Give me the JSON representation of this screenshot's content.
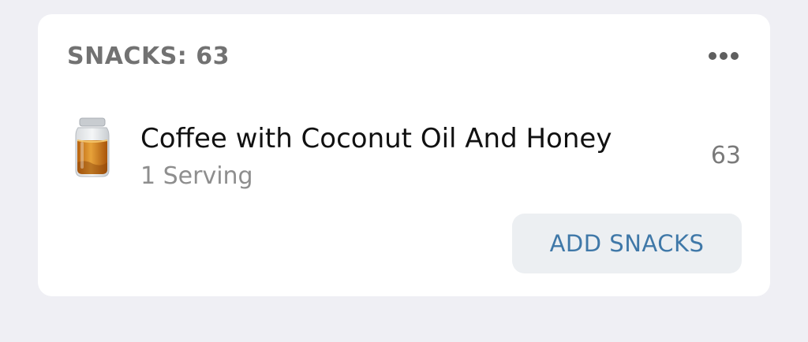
{
  "section": {
    "title": "SNACKS: 63",
    "more_icon": "more-horizontal-icon"
  },
  "entries": [
    {
      "icon": "honey-jar-icon",
      "name": "Coffee with Coconut Oil And Honey",
      "serving": "1 Serving",
      "calories": "63"
    }
  ],
  "actions": {
    "add_label": "ADD SNACKS"
  },
  "colors": {
    "page_bg": "#efeff4",
    "card_bg": "#ffffff",
    "accent": "#3f78a8",
    "button_bg": "#eceff2"
  }
}
